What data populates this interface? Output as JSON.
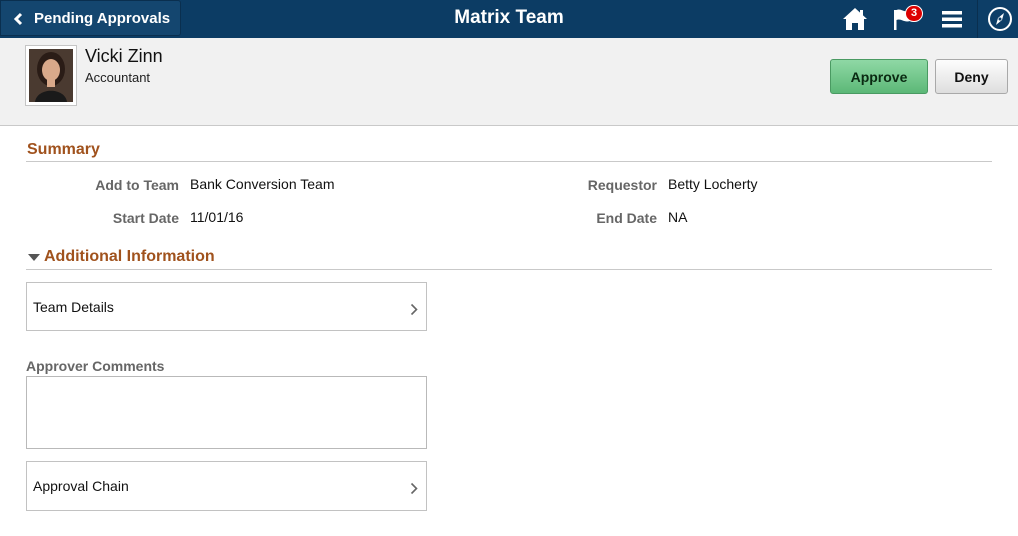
{
  "header": {
    "back_label": "Pending Approvals",
    "title": "Matrix Team",
    "notification_count": "3",
    "icons": [
      "home-icon",
      "flag-icon",
      "menu-icon",
      "navbar-compass-icon"
    ],
    "colors": {
      "bar": "#0c3c64",
      "badge": "#dd0000"
    }
  },
  "person": {
    "name": "Vicki Zinn",
    "title": "Accountant"
  },
  "actions": {
    "approve_label": "Approve",
    "deny_label": "Deny",
    "approve_color": "#6fc688"
  },
  "summary": {
    "title": "Summary",
    "fields": {
      "add_to_team": {
        "label": "Add to Team",
        "value": "Bank Conversion Team"
      },
      "requestor": {
        "label": "Requestor",
        "value": "Betty Locherty"
      },
      "start_date": {
        "label": "Start Date",
        "value": "11/01/16"
      },
      "end_date": {
        "label": "End Date",
        "value": "NA"
      }
    }
  },
  "additional": {
    "title": "Additional Information",
    "team_details_label": "Team Details"
  },
  "comments": {
    "label": "Approver Comments",
    "value": ""
  },
  "approval_chain_label": "Approval Chain",
  "accent_color": "#a0521d"
}
